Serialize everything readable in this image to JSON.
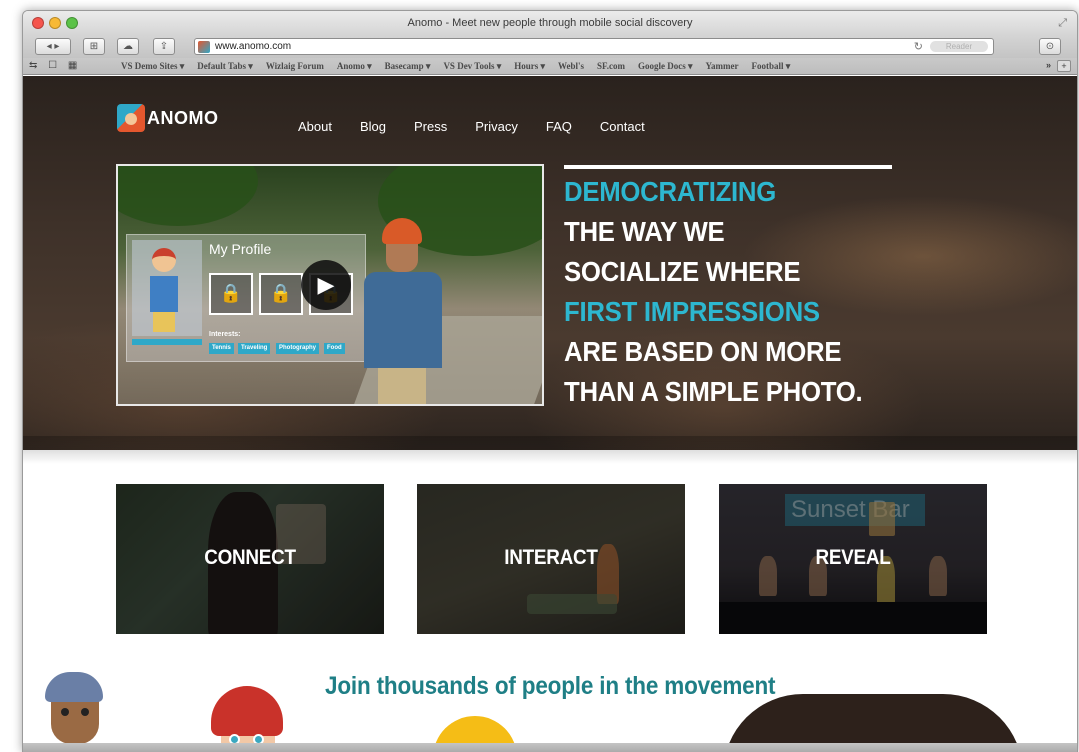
{
  "window": {
    "title": "Anomo - Meet new people through mobile social discovery",
    "url": "www.anomo.com",
    "reader_label": "Reader"
  },
  "bookmarks": [
    "VS Demo Sites ▾",
    "Default Tabs ▾",
    "Wizlaig Forum",
    "Anomo ▾",
    "Basecamp ▾",
    "VS Dev Tools ▾",
    "Hours ▾",
    "Webl's",
    "SF.com",
    "Google Docs ▾",
    "Yammer",
    "Football ▾"
  ],
  "bookmarks_more": "»",
  "brand": {
    "name": "ANOMO",
    "colors": {
      "teal": "#2db7d0",
      "orange": "#e4572e",
      "dark_teal": "#1f7f86"
    }
  },
  "nav": [
    "About",
    "Blog",
    "Press",
    "Privacy",
    "FAQ",
    "Contact"
  ],
  "video": {
    "profile_title": "My Profile",
    "interests_label": "Interests:",
    "interests": [
      "Tennis",
      "Traveling",
      "Photography",
      "Food"
    ]
  },
  "headline": {
    "line1": "DEMOCRATIZING",
    "line2": "THE WAY WE",
    "line3": "SOCIALIZE WHERE",
    "line4": "FIRST IMPRESSIONS",
    "line5": "ARE BASED ON MORE",
    "line6": "THAN A SIMPLE PHOTO."
  },
  "features": [
    {
      "label": "CONNECT"
    },
    {
      "label": "INTERACT"
    },
    {
      "label": "REVEAL",
      "sign": "Sunset Bar"
    }
  ],
  "join_text": "Join thousands of people in the movement"
}
